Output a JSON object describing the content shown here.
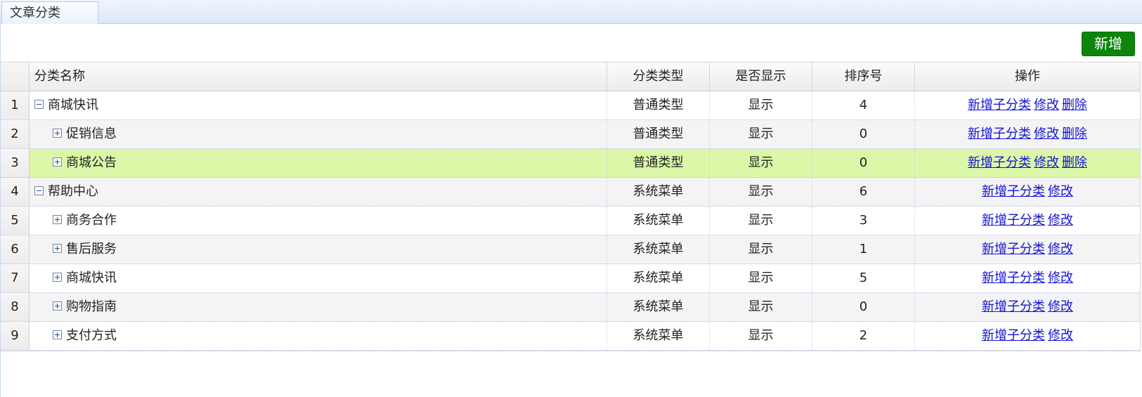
{
  "tab": {
    "title": "文章分类"
  },
  "toolbar": {
    "add_label": "新增"
  },
  "table": {
    "headers": {
      "name": "分类名称",
      "type": "分类类型",
      "show": "是否显示",
      "sort": "排序号",
      "ops": "操作"
    },
    "rows": [
      {
        "idx": "1",
        "name": "商城快讯",
        "level": 0,
        "toggle": "minus",
        "type": "普通类型",
        "show": "显示",
        "sort": "4",
        "ops": [
          "新增子分类",
          "修改",
          "删除"
        ]
      },
      {
        "idx": "2",
        "name": "促销信息",
        "level": 1,
        "toggle": "plus",
        "type": "普通类型",
        "show": "显示",
        "sort": "0",
        "ops": [
          "新增子分类",
          "修改",
          "删除"
        ]
      },
      {
        "idx": "3",
        "name": "商城公告",
        "level": 1,
        "toggle": "plus",
        "type": "普通类型",
        "show": "显示",
        "sort": "0",
        "ops": [
          "新增子分类",
          "修改",
          "删除"
        ],
        "selected": true
      },
      {
        "idx": "4",
        "name": "帮助中心",
        "level": 0,
        "toggle": "minus",
        "type": "系统菜单",
        "show": "显示",
        "sort": "6",
        "ops": [
          "新增子分类",
          "修改"
        ]
      },
      {
        "idx": "5",
        "name": "商务合作",
        "level": 1,
        "toggle": "plus",
        "type": "系统菜单",
        "show": "显示",
        "sort": "3",
        "ops": [
          "新增子分类",
          "修改"
        ]
      },
      {
        "idx": "6",
        "name": "售后服务",
        "level": 1,
        "toggle": "plus",
        "type": "系统菜单",
        "show": "显示",
        "sort": "1",
        "ops": [
          "新增子分类",
          "修改"
        ]
      },
      {
        "idx": "7",
        "name": "商城快讯",
        "level": 1,
        "toggle": "plus",
        "type": "系统菜单",
        "show": "显示",
        "sort": "5",
        "ops": [
          "新增子分类",
          "修改"
        ]
      },
      {
        "idx": "8",
        "name": "购物指南",
        "level": 1,
        "toggle": "plus",
        "type": "系统菜单",
        "show": "显示",
        "sort": "0",
        "ops": [
          "新增子分类",
          "修改"
        ]
      },
      {
        "idx": "9",
        "name": "支付方式",
        "level": 1,
        "toggle": "plus",
        "type": "系统菜单",
        "show": "显示",
        "sort": "2",
        "ops": [
          "新增子分类",
          "修改"
        ]
      }
    ]
  },
  "colors": {
    "add_button": "#0b860b",
    "selected_row": "#dcf7a8",
    "link": "#1515d6"
  }
}
